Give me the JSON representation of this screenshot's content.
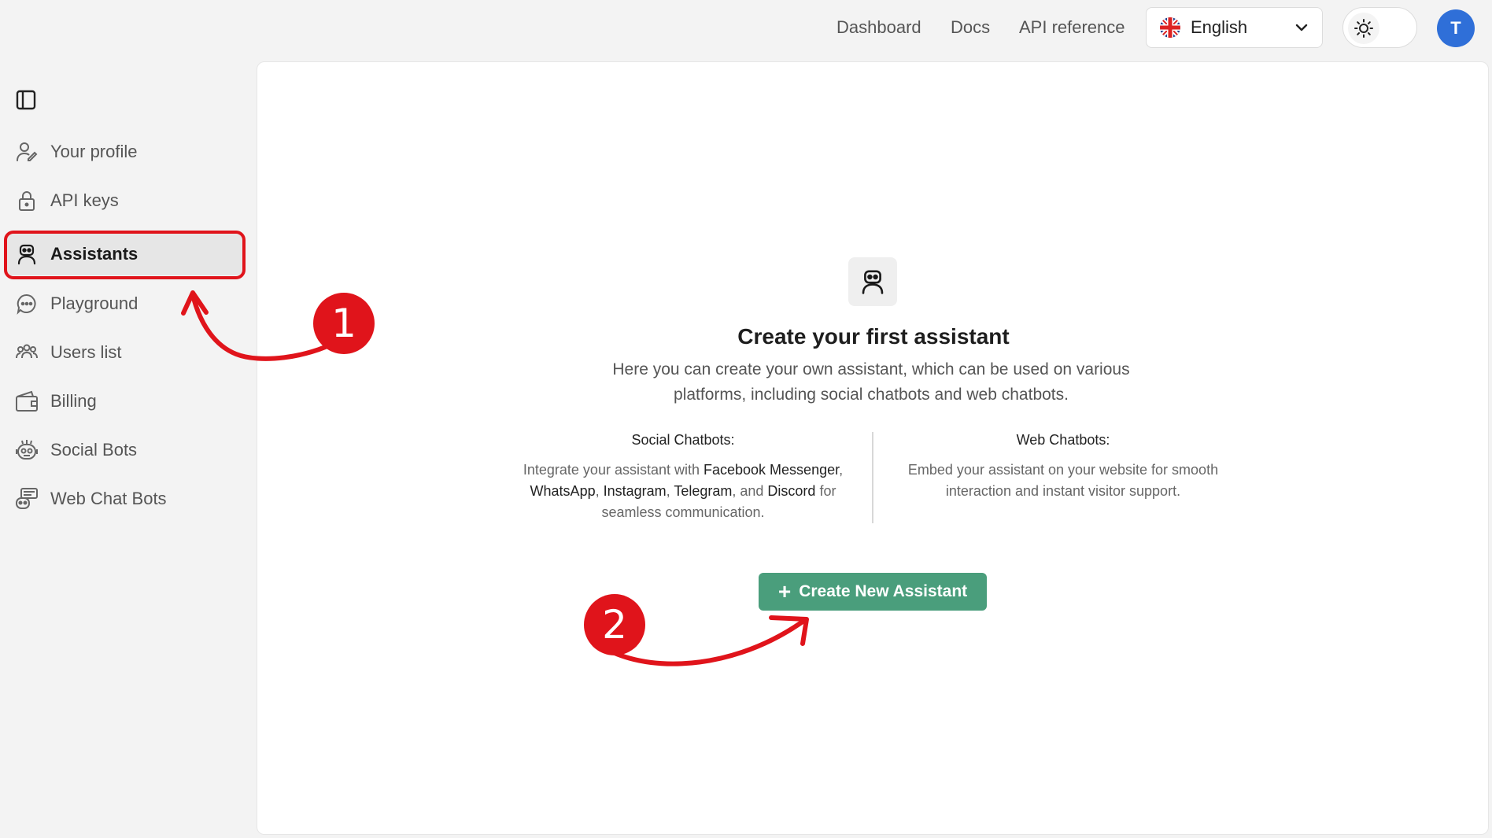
{
  "header": {
    "links": [
      "Dashboard",
      "Docs",
      "API reference"
    ],
    "language": "English",
    "avatar_initial": "T"
  },
  "sidebar": {
    "items": [
      {
        "label": "Your profile",
        "icon": "user-pen-icon"
      },
      {
        "label": "API keys",
        "icon": "lock-icon"
      },
      {
        "label": "Assistants",
        "icon": "robot-icon",
        "active": true
      },
      {
        "label": "Playground",
        "icon": "chat-bubble-icon"
      },
      {
        "label": "Users list",
        "icon": "users-icon"
      },
      {
        "label": "Billing",
        "icon": "wallet-icon"
      },
      {
        "label": "Social Bots",
        "icon": "social-bot-icon"
      },
      {
        "label": "Web Chat Bots",
        "icon": "web-bot-icon"
      }
    ]
  },
  "main": {
    "title": "Create your first assistant",
    "subtitle": "Here you can create your own assistant, which can be used on various platforms, including social chatbots and web chatbots.",
    "social": {
      "heading": "Social Chatbots:",
      "text_1": "Integrate your assistant with ",
      "facebook": "Facebook Messenger",
      "comma1": ", ",
      "whatsapp": "WhatsApp",
      "comma2": ", ",
      "instagram": "Instagram",
      "comma3": ", ",
      "telegram": "Telegram",
      "and": ", and ",
      "discord": "Discord",
      "text_2": " for seamless communication."
    },
    "web": {
      "heading": "Web Chatbots:",
      "text": "Embed your assistant on your website for smooth interaction and instant visitor support."
    },
    "create_button": "Create New Assistant"
  },
  "annotations": {
    "step1": "1",
    "step2": "2",
    "color": "#e0141b"
  },
  "colors": {
    "accent_green": "#4a9e7c",
    "avatar_blue": "#2f6fd8"
  }
}
